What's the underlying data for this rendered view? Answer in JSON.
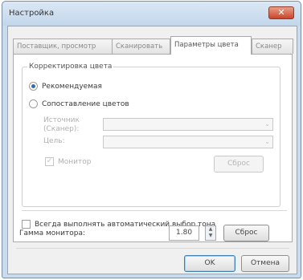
{
  "window": {
    "title": "Настройка",
    "close_label": "✕"
  },
  "tabs": [
    {
      "label": "Поставщик, просмотр"
    },
    {
      "label": "Сканировать"
    },
    {
      "label": "Параметры цвета"
    },
    {
      "label": "Сканер"
    }
  ],
  "color_settings": {
    "group_label": "Корректировка цвета",
    "radio_recommended": "Рекомендуемая",
    "radio_matching": "Сопоставление цветов",
    "source_label_line1": "Источник",
    "source_label_line2": "(Сканер):",
    "target_label": "Цель:",
    "source_value": "",
    "target_value": "",
    "monitor_checkbox": "Монитор",
    "reset_button": "Сброс"
  },
  "auto_exposure_label": "Всегда выполнять автоматический выбор тона",
  "gamma": {
    "label": "Гамма монитора:",
    "value": "1.80",
    "reset_button": "Сброс"
  },
  "footer": {
    "ok_label": "OK",
    "cancel_label": "Отмена"
  },
  "icons": {
    "close": "close-icon",
    "dropdown": "chevron-down-icon",
    "spin": "spin-updown-icon"
  }
}
